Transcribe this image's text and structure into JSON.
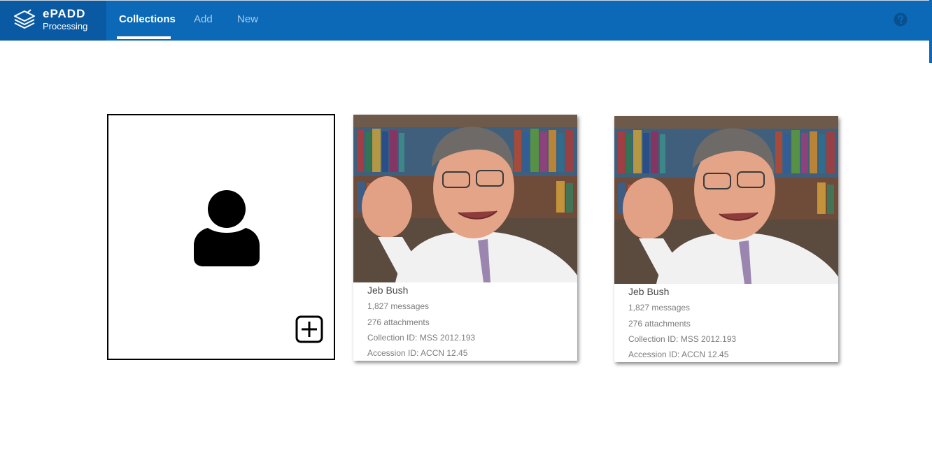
{
  "app": {
    "brand_name": "ePADD",
    "brand_sub": "Processing"
  },
  "nav": {
    "tabs": [
      {
        "label": "Collections",
        "active": true
      },
      {
        "label": "Add",
        "active": false
      },
      {
        "label": "New",
        "active": false
      }
    ],
    "help_icon": "question-circle-icon"
  },
  "colors": {
    "topbar": "#0b69b7",
    "brand_bg": "#0a5aa3",
    "inactive_tab": "#aecbe6"
  },
  "add_card": {
    "person_icon": "person-icon",
    "add_icon": "plus-square-icon"
  },
  "collections": [
    {
      "name": "Jeb Bush",
      "messages": "1,827 messages",
      "attachments": "276 attachments",
      "collection_id": "Collection ID: MSS 2012.193",
      "accession_id": "Accession ID: ACCN 12.45"
    },
    {
      "name": "Jeb Bush",
      "messages": "1,827 messages",
      "attachments": "276 attachments",
      "collection_id": "Collection ID: MSS 2012.193",
      "accession_id": "Accession ID: ACCN 12.45"
    }
  ]
}
